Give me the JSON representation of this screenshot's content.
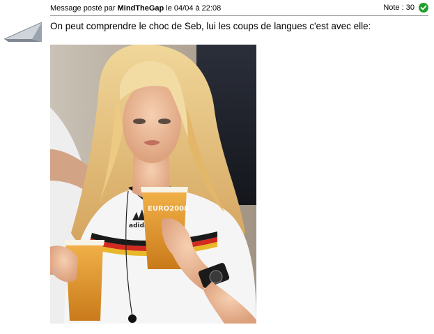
{
  "post": {
    "meta_prefix": "Message posté par",
    "author": "MindTheGap",
    "date_prefix": "le",
    "date": "04/04 à 22:08",
    "note_label": "Note : 30",
    "body_text": "On peut comprendre le choc de Seb, lui les coups de langues c'est avec elle:",
    "image_caption": "EURO2008",
    "brand_text": "adidas"
  },
  "colors": {
    "rating_check": "#1fa02d",
    "divider": "#9a9a9a"
  },
  "icons": {
    "avatar": "paper-plane-icon",
    "rating": "check-circle-icon"
  }
}
